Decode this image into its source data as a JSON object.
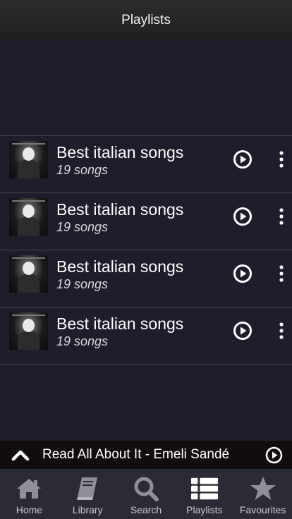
{
  "header": {
    "title": "Playlists"
  },
  "playlists": [
    {
      "title": "Best italian songs",
      "count": "19 songs"
    },
    {
      "title": "Best italian songs",
      "count": "19 songs"
    },
    {
      "title": "Best italian songs",
      "count": "19 songs"
    },
    {
      "title": "Best italian songs",
      "count": "19 songs"
    }
  ],
  "now_playing": {
    "title": "Read All About It - Emeli Sandé"
  },
  "tabs": [
    {
      "label": "Home",
      "icon": "home-icon"
    },
    {
      "label": "Library",
      "icon": "book-icon"
    },
    {
      "label": "Search",
      "icon": "search-icon"
    },
    {
      "label": "Playlists",
      "icon": "list-icon"
    },
    {
      "label": "Favourites",
      "icon": "star-icon"
    }
  ],
  "colors": {
    "background": "#1e1d2b",
    "tabbar": "#2b2b36",
    "now_playing_bg": "#120d0d",
    "icon": "#8f8f99"
  }
}
